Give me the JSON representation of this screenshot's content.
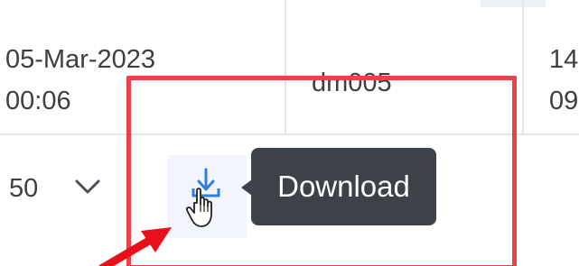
{
  "table": {
    "row": {
      "date_line1": "05-Mar-2023",
      "time_line2": "00:06",
      "user": "dm005",
      "next_line1": "14",
      "next_line2": "09"
    }
  },
  "pagination": {
    "page_size": "50",
    "chevron_icon": "chevron-down-icon"
  },
  "download": {
    "icon": "download-icon",
    "tooltip": "Download"
  },
  "annotation": {
    "highlight_color": "#e8424a",
    "arrow_color": "#e8101a"
  },
  "colors": {
    "tooltip_bg": "#3d4248",
    "icon_blue": "#2f7de1",
    "grid_line": "#e3e6ea"
  }
}
